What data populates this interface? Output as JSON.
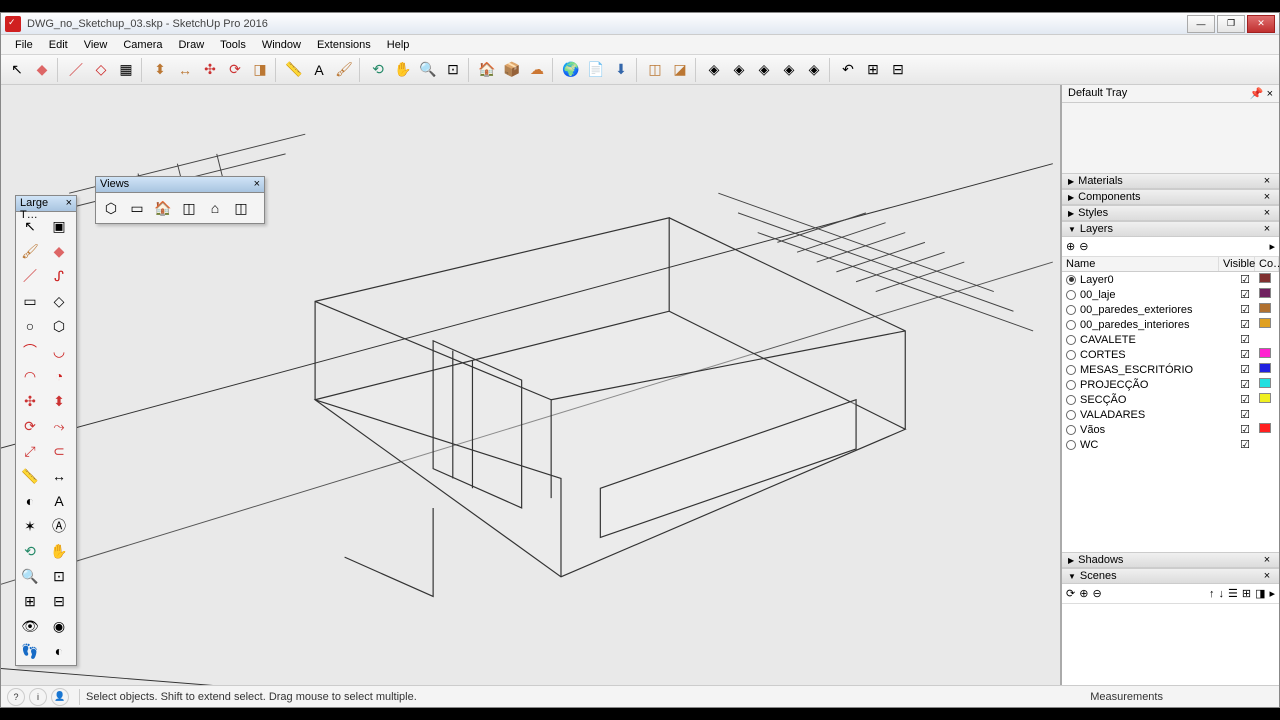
{
  "window": {
    "title": "DWG_no_Sketchup_03.skp - SketchUp Pro 2016",
    "min": "—",
    "max": "❐",
    "close": "✕"
  },
  "menu": [
    "File",
    "Edit",
    "View",
    "Camera",
    "Draw",
    "Tools",
    "Window",
    "Extensions",
    "Help"
  ],
  "toolboxes": {
    "large_title": "Large T…",
    "views_title": "Views"
  },
  "tray": {
    "header": "Default Tray",
    "panels": {
      "materials": "Materials",
      "components": "Components",
      "styles": "Styles",
      "layers": "Layers",
      "shadows": "Shadows",
      "scenes": "Scenes"
    }
  },
  "layers": {
    "columns": {
      "name": "Name",
      "visible": "Visible",
      "color": "Co…"
    },
    "toolbar": {
      "add": "⊕",
      "del": "⊖",
      "menu": "▸"
    },
    "items": [
      {
        "name": "Layer0",
        "active": true,
        "color": "#803030"
      },
      {
        "name": "00_laje",
        "active": false,
        "color": "#702060"
      },
      {
        "name": "00_paredes_exteriores",
        "active": false,
        "color": "#b07030"
      },
      {
        "name": "00_paredes_interiores",
        "active": false,
        "color": "#e0a020"
      },
      {
        "name": "CAVALETE",
        "active": false,
        "color": ""
      },
      {
        "name": "CORTES",
        "active": false,
        "color": "#ff20d0"
      },
      {
        "name": "MESAS_ESCRITÓRIO",
        "active": false,
        "color": "#2020e0"
      },
      {
        "name": "PROJECÇÃO",
        "active": false,
        "color": "#20e0e0"
      },
      {
        "name": "SECÇÃO",
        "active": false,
        "color": "#f0f020"
      },
      {
        "name": "VALADARES",
        "active": false,
        "color": ""
      },
      {
        "name": "Vãos",
        "active": false,
        "color": "#ff2020"
      },
      {
        "name": "WC",
        "active": false,
        "color": ""
      }
    ]
  },
  "status": {
    "hint": "Select objects. Shift to extend select. Drag mouse to select multiple.",
    "measurements": "Measurements"
  }
}
